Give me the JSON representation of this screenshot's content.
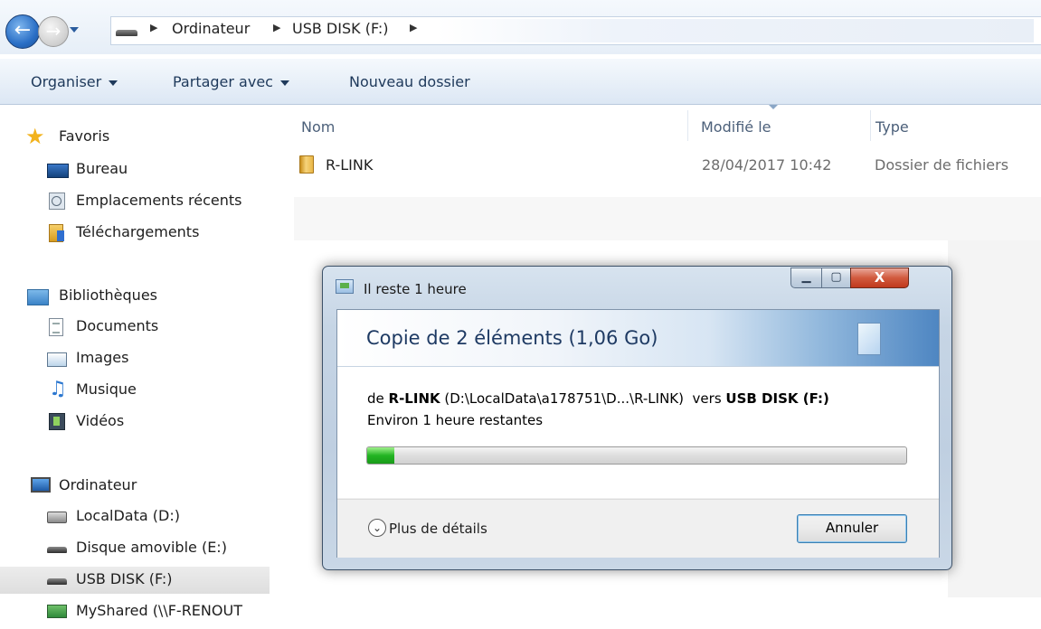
{
  "addressbar": {
    "breadcrumbs": [
      "Ordinateur",
      "USB DISK (F:)"
    ]
  },
  "toolbar": {
    "organize": "Organiser",
    "share": "Partager avec",
    "new_folder": "Nouveau dossier"
  },
  "nav": {
    "favorites": {
      "label": "Favoris",
      "items": [
        "Bureau",
        "Emplacements récents",
        "Téléchargements"
      ]
    },
    "libraries": {
      "label": "Bibliothèques",
      "items": [
        "Documents",
        "Images",
        "Musique",
        "Vidéos"
      ]
    },
    "computer": {
      "label": "Ordinateur",
      "items": [
        "LocalData (D:)",
        "Disque amovible (E:)",
        "USB DISK (F:)",
        "MyShared (\\\\F-RENOUT"
      ]
    },
    "selected": "USB DISK (F:)"
  },
  "columns": {
    "name": "Nom",
    "modified": "Modifié le",
    "type": "Type"
  },
  "files": [
    {
      "name": "R-LINK",
      "modified": "28/04/2017 10:42",
      "type": "Dossier de fichiers"
    }
  ],
  "dialog": {
    "title": "Il reste 1 heure",
    "window_buttons": {
      "minimize": "▁",
      "maximize": "▢",
      "close": "X"
    },
    "heading": "Copie de 2 éléments (1,06 Go)",
    "from_prefix": "de",
    "source_name": "R-LINK",
    "source_path": "(D:\\LocalData\\a178751\\D...\\R-LINK)",
    "to_prefix": "vers",
    "destination": "USB DISK (F:)",
    "time_remaining": "Environ 1 heure restantes",
    "progress_fraction": 0.05,
    "more_details": "Plus de détails",
    "cancel": "Annuler"
  },
  "colors": {
    "progress_green": "#23b423",
    "banner_blue": "#4e86c2",
    "heading_blue": "#1e3a63",
    "close_red": "#c0391d"
  }
}
